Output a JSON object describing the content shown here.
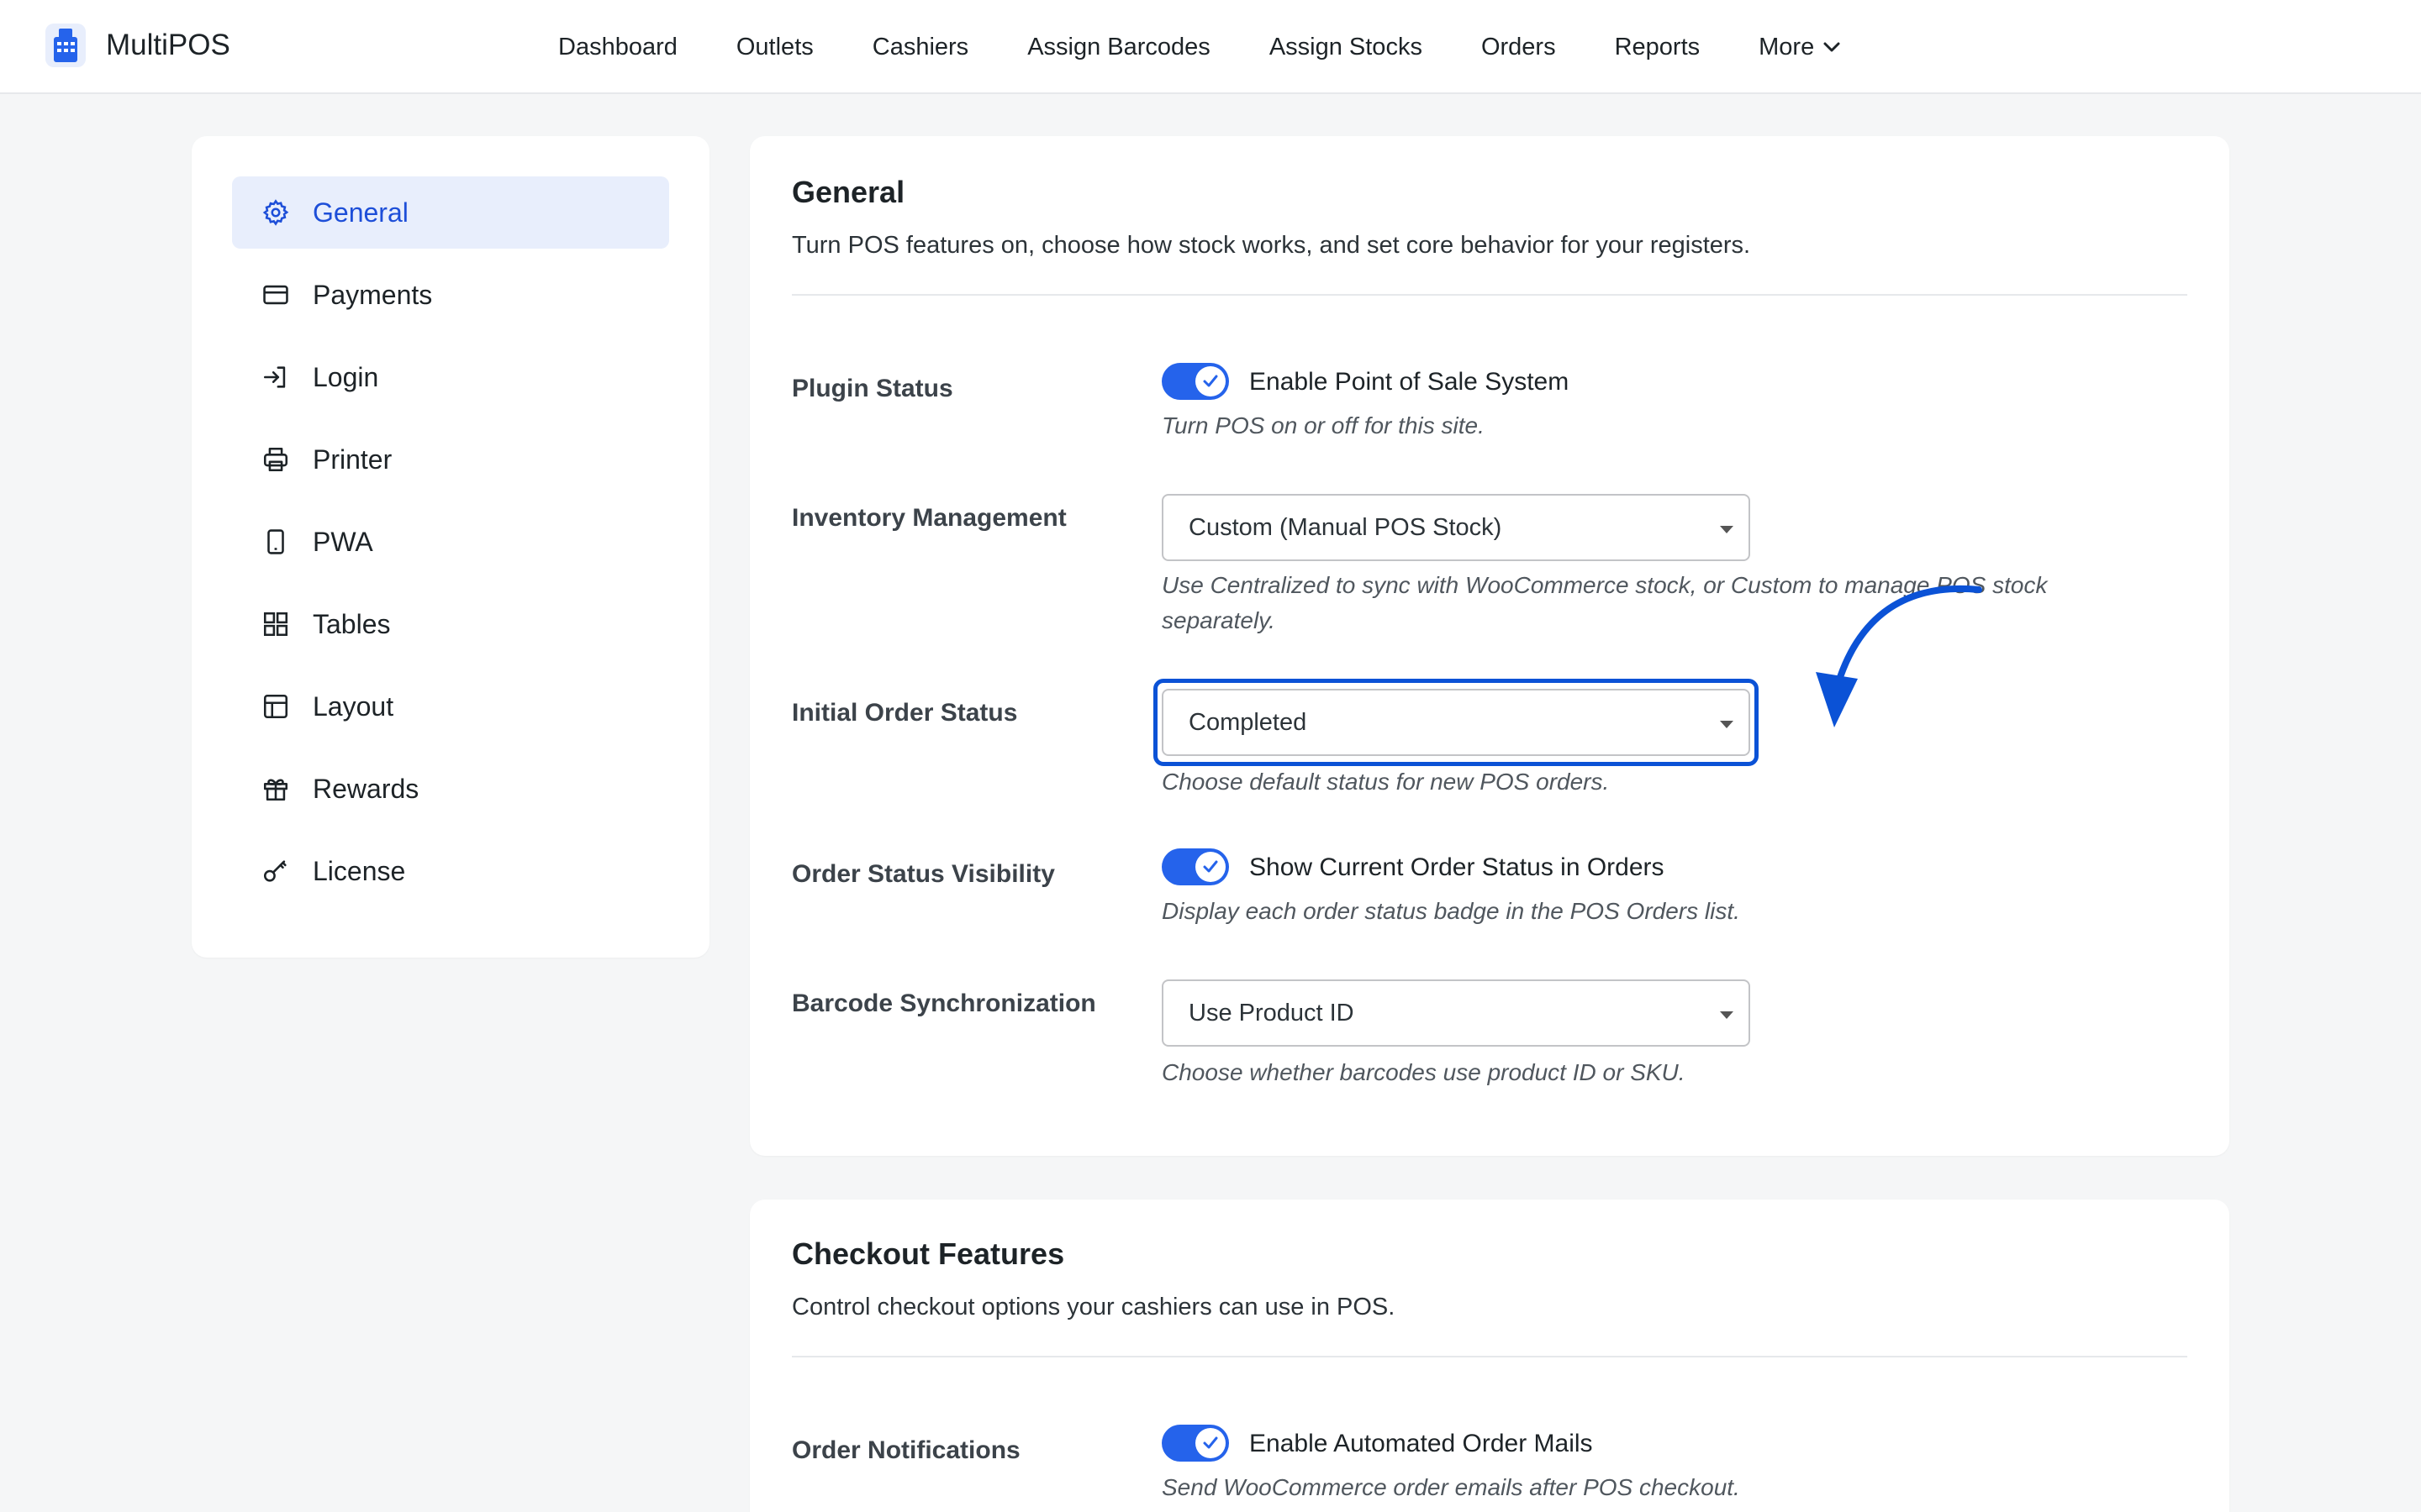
{
  "app": {
    "name": "MultiPOS"
  },
  "nav": {
    "items": [
      "Dashboard",
      "Outlets",
      "Cashiers",
      "Assign Barcodes",
      "Assign Stocks",
      "Orders",
      "Reports"
    ],
    "more_label": "More"
  },
  "sidebar": {
    "items": [
      {
        "label": "General",
        "icon": "gear-icon",
        "active": true
      },
      {
        "label": "Payments",
        "icon": "credit-card-icon"
      },
      {
        "label": "Login",
        "icon": "login-icon"
      },
      {
        "label": "Printer",
        "icon": "printer-icon"
      },
      {
        "label": "PWA",
        "icon": "mobile-icon"
      },
      {
        "label": "Tables",
        "icon": "grid-icon"
      },
      {
        "label": "Layout",
        "icon": "layout-icon"
      },
      {
        "label": "Rewards",
        "icon": "gift-icon"
      },
      {
        "label": "License",
        "icon": "key-icon"
      }
    ]
  },
  "general": {
    "title": "General",
    "description": "Turn POS features on, choose how stock works, and set core behavior for your registers.",
    "plugin_status": {
      "label": "Plugin Status",
      "toggle_text": "Enable Point of Sale System",
      "enabled": true,
      "help": "Turn POS on or off for this site."
    },
    "inventory": {
      "label": "Inventory Management",
      "value": "Custom (Manual POS Stock)",
      "help_line1": "Use Centralized to sync with WooCommerce stock, or Custom to manage POS stock",
      "help_line2": "separately."
    },
    "initial_order_status": {
      "label": "Initial Order Status",
      "value": "Completed",
      "help": "Choose default status for new POS orders."
    },
    "order_status_visibility": {
      "label": "Order Status Visibility",
      "toggle_text": "Show Current Order Status in Orders",
      "enabled": true,
      "help": "Display each order status badge in the POS Orders list."
    },
    "barcode_sync": {
      "label": "Barcode Synchronization",
      "value": "Use Product ID",
      "help": "Choose whether barcodes use product ID or SKU."
    }
  },
  "checkout": {
    "title": "Checkout Features",
    "description": "Control checkout options your cashiers can use in POS.",
    "order_notifications": {
      "label": "Order Notifications",
      "toggle_text": "Enable Automated Order Mails",
      "enabled": true,
      "help": "Send WooCommerce order emails after POS checkout."
    }
  },
  "colors": {
    "accent": "#2563eb",
    "highlight": "#0b52d6",
    "active_bg": "#e8eefc"
  }
}
